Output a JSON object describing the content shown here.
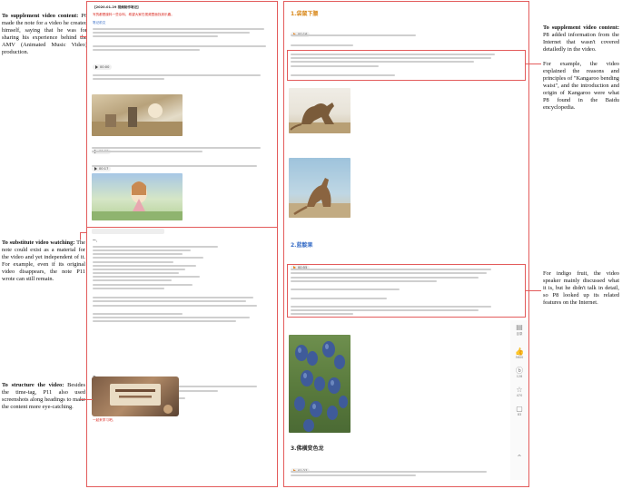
{
  "annotations": {
    "supplement_left": {
      "title": "To supplement video content:",
      "body": "P6 made the note for a video he created himself, saying that he was for sharing his experience behind the AMV (Animated Music Video) production."
    },
    "substitute": {
      "title": "To substitute video watching:",
      "body": "The note could exist as a material for the video and yet independent of it. For example, even if its original video disappears, the note P11 wrote can still remain."
    },
    "structure": {
      "title": "To structure the video:",
      "body": "Besides the time-tag, P11 also used screenshots along headings to make the content more eye-catching."
    },
    "supplement_right": {
      "title": "To supplement video content:",
      "body1": "P8 added information from the Internet that wasn't covered detailedly in the video.",
      "body2": "For example, the video explained the reasons and principles of \"Kangaroo bending waist\", and the introduction and origin of Kangaroo were what P8 found in the Baidu encyclopedia."
    },
    "indigo": {
      "body": "For indigo fruit, the video speaker mainly discussed what it is, but he didn't talk in detail, so P8 looked up its related features on the Internet."
    }
  },
  "left_note": {
    "date_title": "【2020.01.29 视频制作笔记】",
    "red_intro": "写的都是废料一些杂料，希望大家在视频里面找到乐趣。",
    "section_label": "笔记前文",
    "timestamps": [
      "00:00",
      "00:00",
      "00:17"
    ],
    "bottom_red": "一起来学习吧。"
  },
  "right_note": {
    "h1": "1.袋鼠下腰",
    "ts1": "00:16",
    "h2": "2.蓝靛果",
    "ts2": "00:55",
    "h3": "3.佛横变色龙",
    "ts3": "01:27"
  },
  "sidebar_icons": [
    {
      "name": "catalog-icon",
      "glyph": "▤",
      "label": "目录"
    },
    {
      "name": "like-icon",
      "glyph": "👍",
      "label": "5600"
    },
    {
      "name": "coin-icon",
      "glyph": "ⓑ",
      "label": "128"
    },
    {
      "name": "star-icon",
      "glyph": "☆",
      "label": "470"
    },
    {
      "name": "comment-icon",
      "glyph": "▢",
      "label": "83"
    },
    {
      "name": "scroll-top-icon",
      "glyph": "⌃",
      "label": ""
    }
  ]
}
